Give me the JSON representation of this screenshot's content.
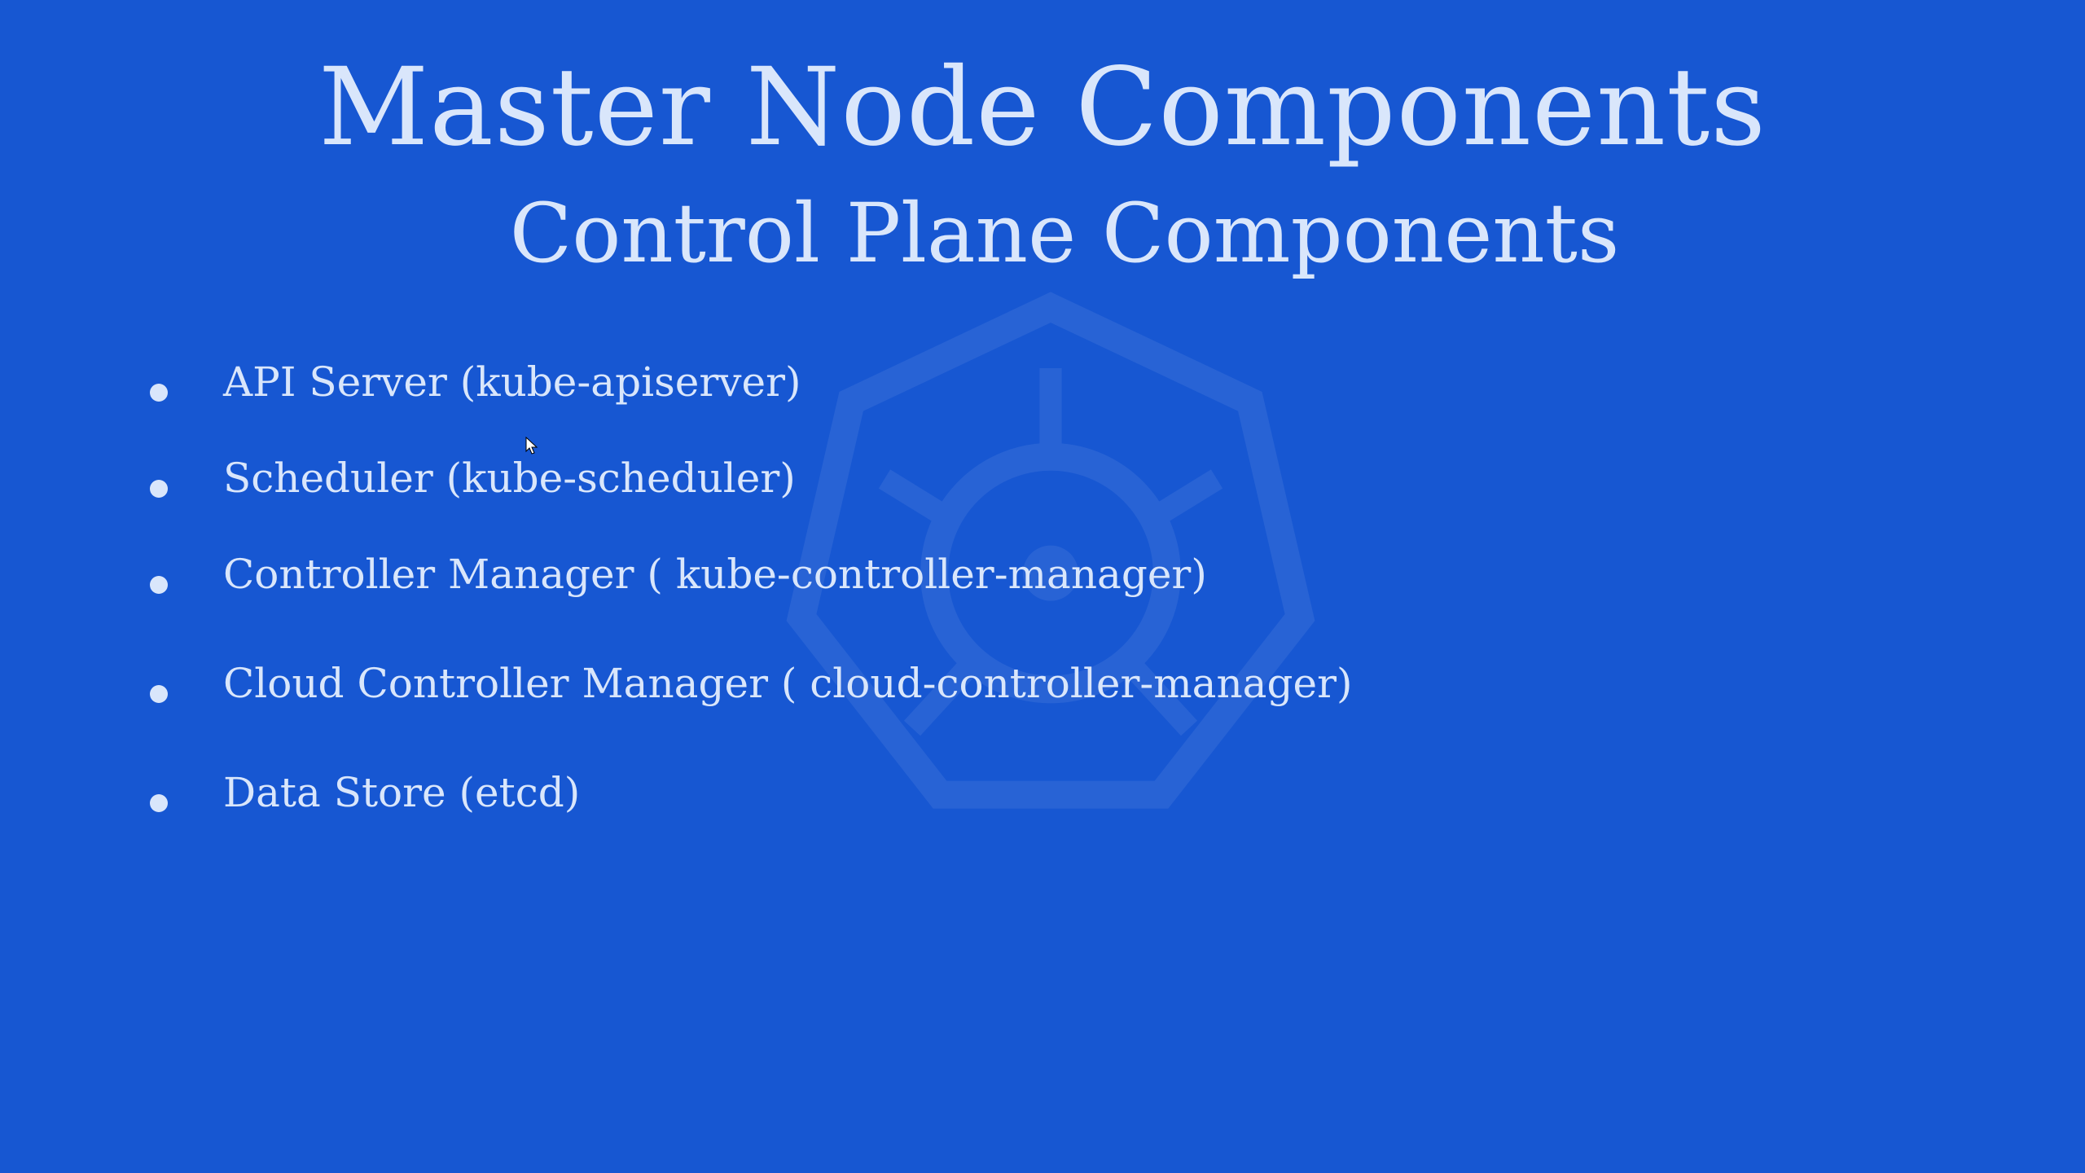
{
  "slide": {
    "title": "Master Node Components",
    "subtitle": "Control Plane Components",
    "bullets": [
      "API Server (kube-apiserver)",
      "Scheduler (kube-scheduler)",
      "Controller Manager ( kube-controller-manager)",
      "Cloud Controller Manager ( cloud-controller-manager)",
      "Data Store (etcd)"
    ],
    "colors": {
      "background": "#1757d2",
      "text": "#d9e6fb"
    },
    "icons": {
      "watermark": "kubernetes-helm-wheel-icon",
      "cursor": "mouse-pointer-icon"
    }
  }
}
